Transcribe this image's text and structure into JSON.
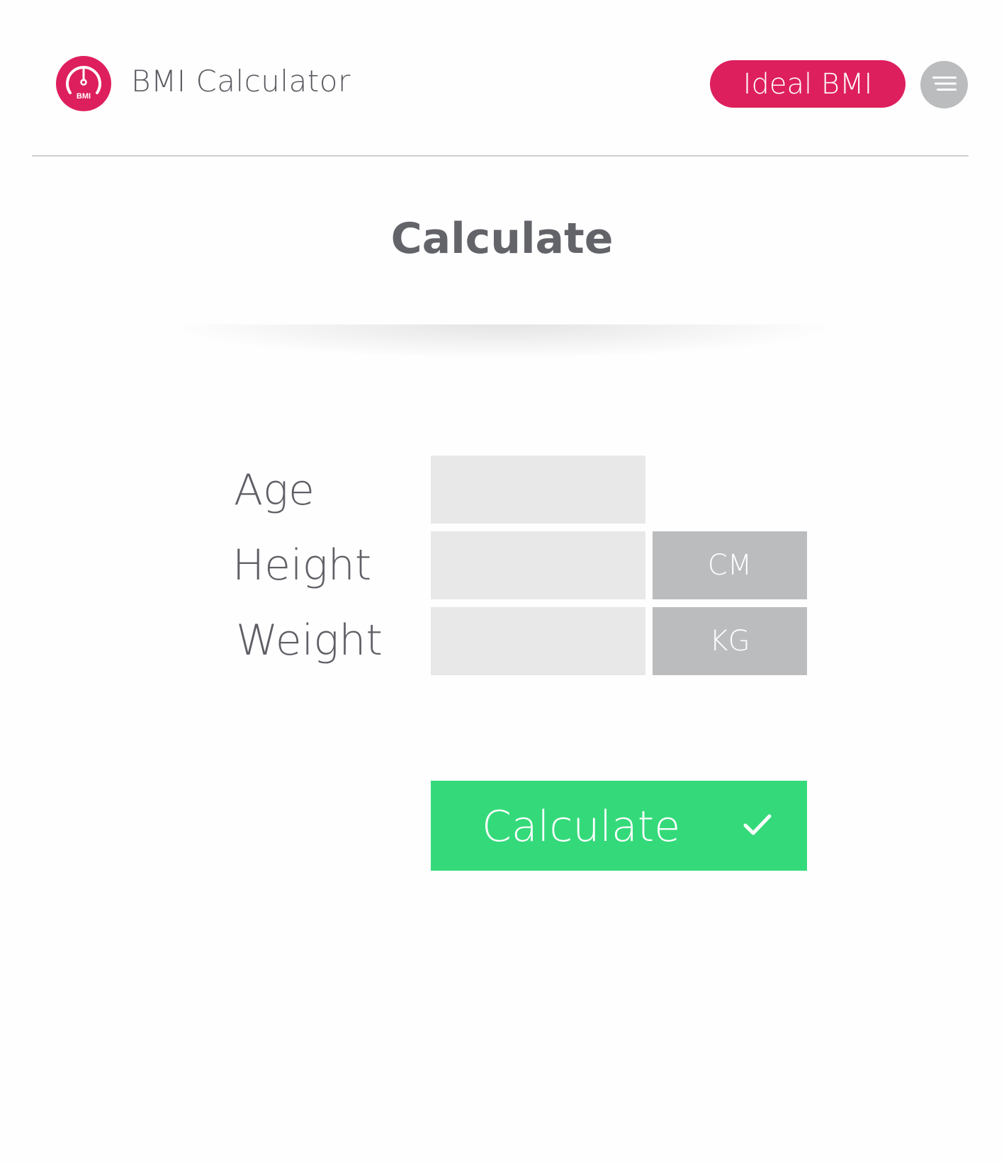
{
  "header": {
    "app_title": "BMI Calculator",
    "logo_text": "BMI",
    "ideal_bmi_label": "Ideal BMI",
    "menu_icon": "menu-icon",
    "accent_color": "#de1f5d"
  },
  "main": {
    "section_title": "Calculate",
    "fields": {
      "age": {
        "label": "Age",
        "value": ""
      },
      "height": {
        "label": "Height",
        "value": "",
        "unit": "CM"
      },
      "weight": {
        "label": "Weight",
        "value": "",
        "unit": "KG"
      }
    },
    "calculate_button": {
      "label": "Calculate",
      "icon": "check-icon",
      "color": "#34da7a"
    }
  }
}
